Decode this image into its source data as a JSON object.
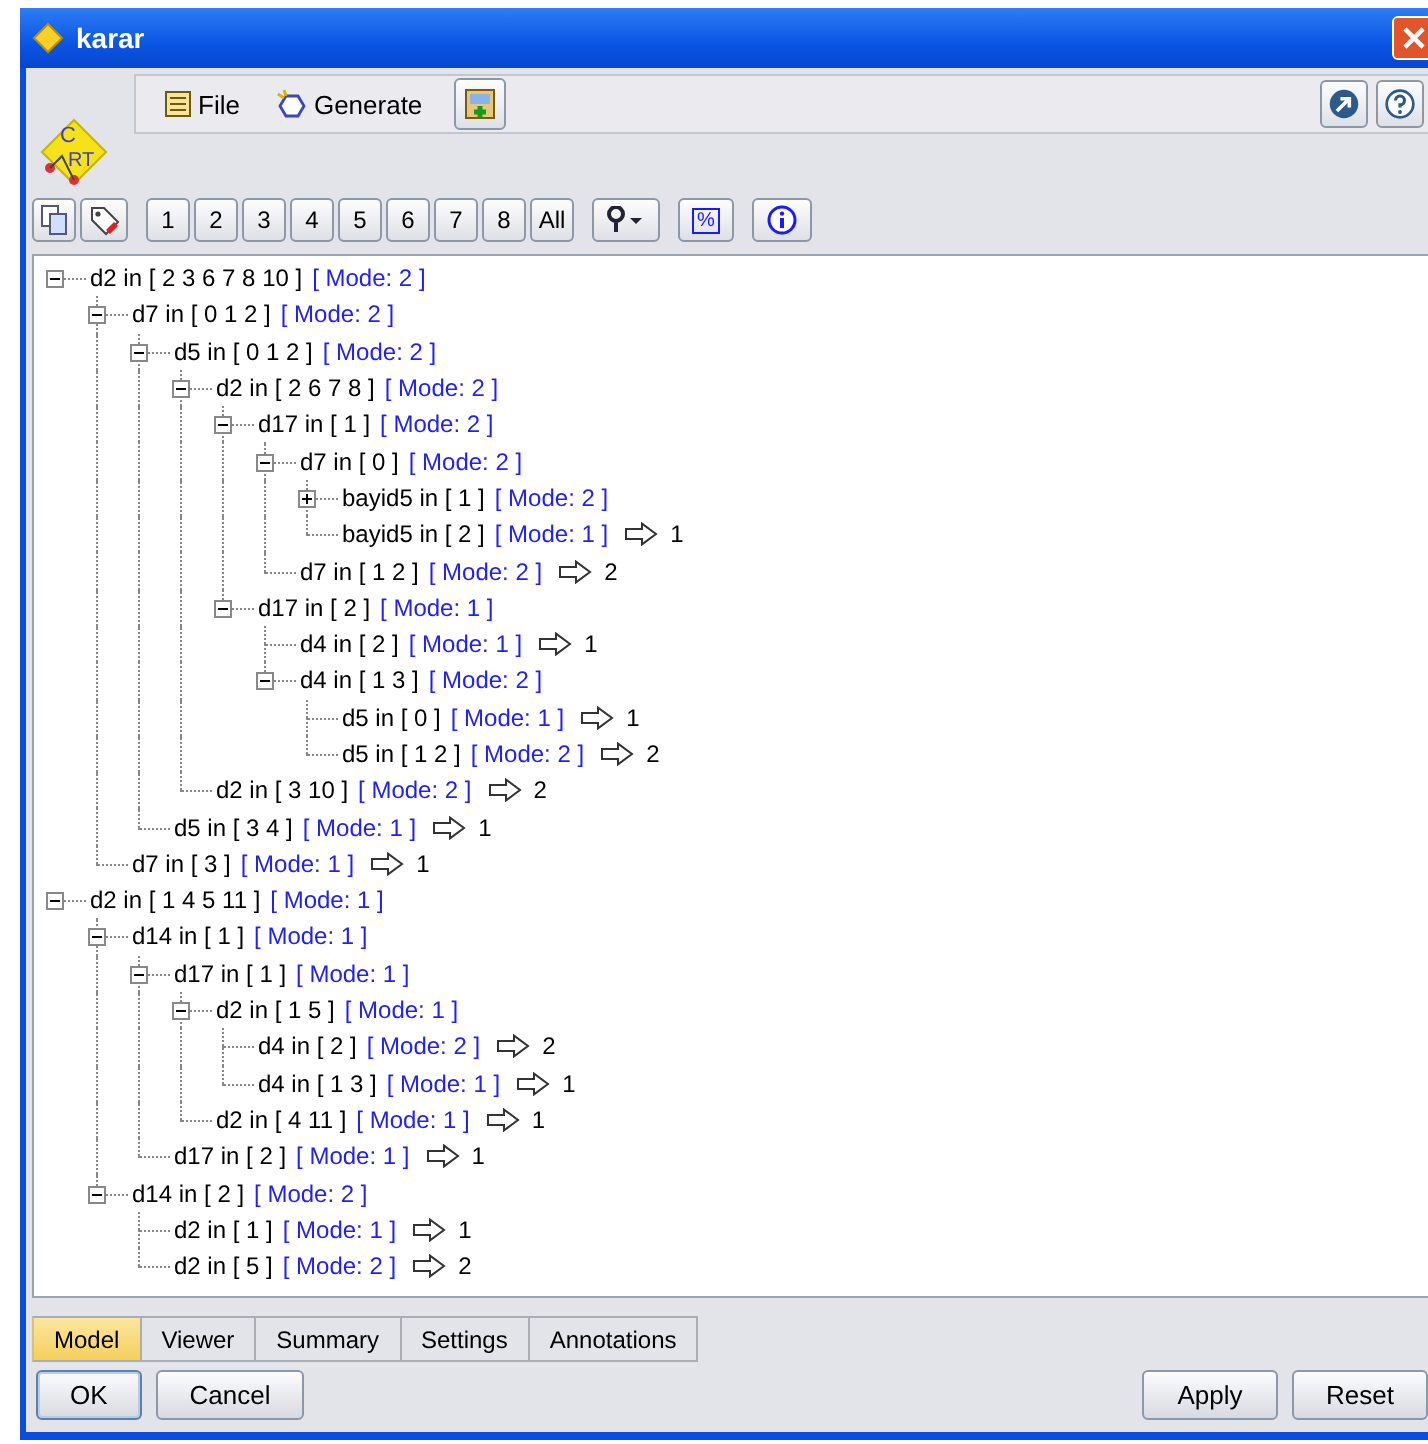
{
  "window": {
    "title": "karar"
  },
  "logo": {
    "top": "C",
    "bottom": "RT"
  },
  "menu": [
    {
      "label": "File",
      "kind": "file"
    },
    {
      "label": "Generate",
      "kind": "generate"
    }
  ],
  "levels": [
    "1",
    "2",
    "3",
    "4",
    "5",
    "6",
    "7",
    "8",
    "All"
  ],
  "percent_label": "%",
  "tree": [
    {
      "label": "d2 in [ 2 3 6 7 8 10 ]",
      "mode": "[ Mode: 2 ]",
      "expanded": true,
      "children": [
        {
          "label": "d7 in [ 0 1 2 ]",
          "mode": "[ Mode: 2 ]",
          "expanded": true,
          "children": [
            {
              "label": "d5 in [ 0 1 2 ]",
              "mode": "[ Mode: 2 ]",
              "expanded": true,
              "children": [
                {
                  "label": "d2 in [ 2 6 7 8 ]",
                  "mode": "[ Mode: 2 ]",
                  "expanded": true,
                  "children": [
                    {
                      "label": "d17 in [ 1 ]",
                      "mode": "[ Mode: 2 ]",
                      "expanded": true,
                      "children": [
                        {
                          "label": "d7 in [ 0 ]",
                          "mode": "[ Mode: 2 ]",
                          "expanded": true,
                          "children": [
                            {
                              "label": "bayid5 in [ 1 ]",
                              "mode": "[ Mode: 2 ]",
                              "expanded": false
                            },
                            {
                              "label": "bayid5 in [ 2 ]",
                              "mode": "[ Mode: 1 ]",
                              "result": "1"
                            }
                          ]
                        },
                        {
                          "label": "d7 in [ 1 2 ]",
                          "mode": "[ Mode: 2 ]",
                          "result": "2"
                        }
                      ]
                    },
                    {
                      "label": "d17 in [ 2 ]",
                      "mode": "[ Mode: 1 ]",
                      "expanded": true,
                      "children": [
                        {
                          "label": "d4 in [ 2 ]",
                          "mode": "[ Mode: 1 ]",
                          "result": "1"
                        },
                        {
                          "label": "d4 in [ 1 3 ]",
                          "mode": "[ Mode: 2 ]",
                          "expanded": true,
                          "children": [
                            {
                              "label": "d5 in [ 0 ]",
                              "mode": "[ Mode: 1 ]",
                              "result": "1"
                            },
                            {
                              "label": "d5 in [ 1 2 ]",
                              "mode": "[ Mode: 2 ]",
                              "result": "2"
                            }
                          ]
                        }
                      ]
                    }
                  ]
                },
                {
                  "label": "d2 in [ 3 10 ]",
                  "mode": "[ Mode: 2 ]",
                  "result": "2"
                }
              ]
            },
            {
              "label": "d5 in [ 3 4 ]",
              "mode": "[ Mode: 1 ]",
              "result": "1"
            }
          ]
        },
        {
          "label": "d7 in [ 3 ]",
          "mode": "[ Mode: 1 ]",
          "result": "1"
        }
      ]
    },
    {
      "label": "d2 in [ 1 4 5 11 ]",
      "mode": "[ Mode: 1 ]",
      "expanded": true,
      "children": [
        {
          "label": "d14 in [ 1 ]",
          "mode": "[ Mode: 1 ]",
          "expanded": true,
          "children": [
            {
              "label": "d17 in [ 1 ]",
              "mode": "[ Mode: 1 ]",
              "expanded": true,
              "children": [
                {
                  "label": "d2 in [ 1 5 ]",
                  "mode": "[ Mode: 1 ]",
                  "expanded": true,
                  "children": [
                    {
                      "label": "d4 in [ 2 ]",
                      "mode": "[ Mode: 2 ]",
                      "result": "2"
                    },
                    {
                      "label": "d4 in [ 1 3 ]",
                      "mode": "[ Mode: 1 ]",
                      "result": "1"
                    }
                  ]
                },
                {
                  "label": "d2 in [ 4 11 ]",
                  "mode": "[ Mode: 1 ]",
                  "result": "1"
                }
              ]
            },
            {
              "label": "d17 in [ 2 ]",
              "mode": "[ Mode: 1 ]",
              "result": "1"
            }
          ]
        },
        {
          "label": "d14 in [ 2 ]",
          "mode": "[ Mode: 2 ]",
          "expanded": true,
          "children": [
            {
              "label": "d2 in [ 1 ]",
              "mode": "[ Mode: 1 ]",
              "result": "1"
            },
            {
              "label": "d2 in [ 5 ]",
              "mode": "[ Mode: 2 ]",
              "result": "2"
            }
          ]
        }
      ]
    }
  ],
  "tabs": [
    {
      "label": "Model",
      "selected": true
    },
    {
      "label": "Viewer",
      "selected": false
    },
    {
      "label": "Summary",
      "selected": false
    },
    {
      "label": "Settings",
      "selected": false
    },
    {
      "label": "Annotations",
      "selected": false
    }
  ],
  "buttons_left": [
    "OK",
    "Cancel"
  ],
  "buttons_right": [
    "Apply",
    "Reset"
  ]
}
